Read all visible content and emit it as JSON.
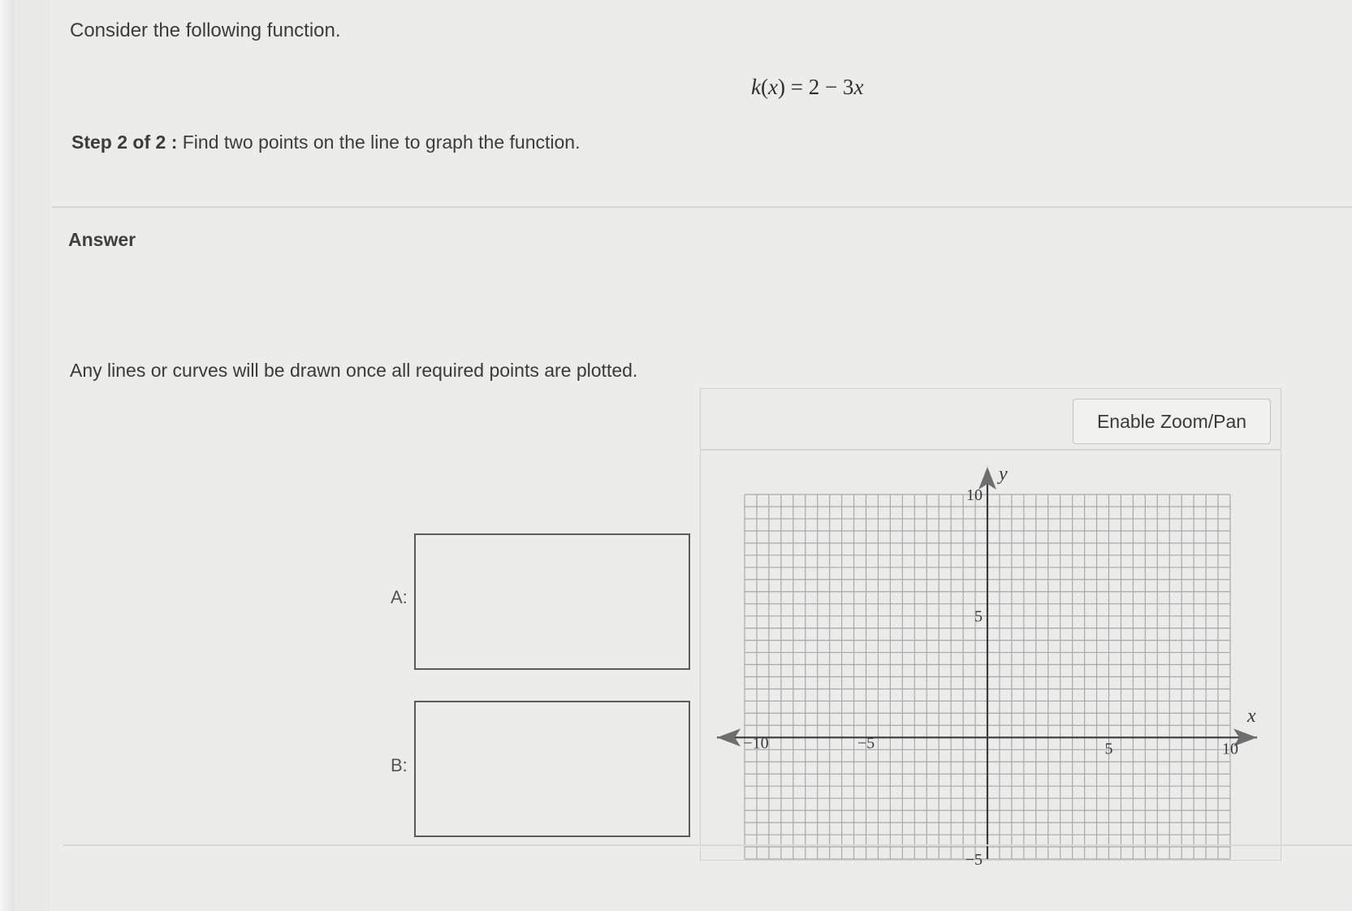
{
  "question": {
    "intro": "Consider the following function.",
    "formula": {
      "lhs_func": "k",
      "lhs_var": "x",
      "equals": "=",
      "rhs": "2 − 3",
      "rhs_var": "x"
    },
    "step_bold": "Step 2 of 2 :",
    "step_text": " Find two points on the line to graph the function."
  },
  "answer": {
    "label": "Answer",
    "note": "Any lines or curves will be drawn once all required points are plotted."
  },
  "points": {
    "a_label": "A:",
    "b_label": "B:",
    "a_value": "",
    "b_value": ""
  },
  "graph": {
    "zoom_button": "Enable Zoom/Pan",
    "x_axis_label": "x",
    "y_axis_label": "y",
    "x_ticks": [
      "−10",
      "−5",
      "5",
      "10"
    ],
    "y_ticks": [
      "10",
      "5",
      "−5"
    ],
    "x_range": [
      -10,
      10
    ],
    "y_range": [
      -5,
      10
    ]
  },
  "colors": {
    "grid": "#a9a9a9",
    "axis": "#3a3a3a",
    "background": "#ececea"
  }
}
